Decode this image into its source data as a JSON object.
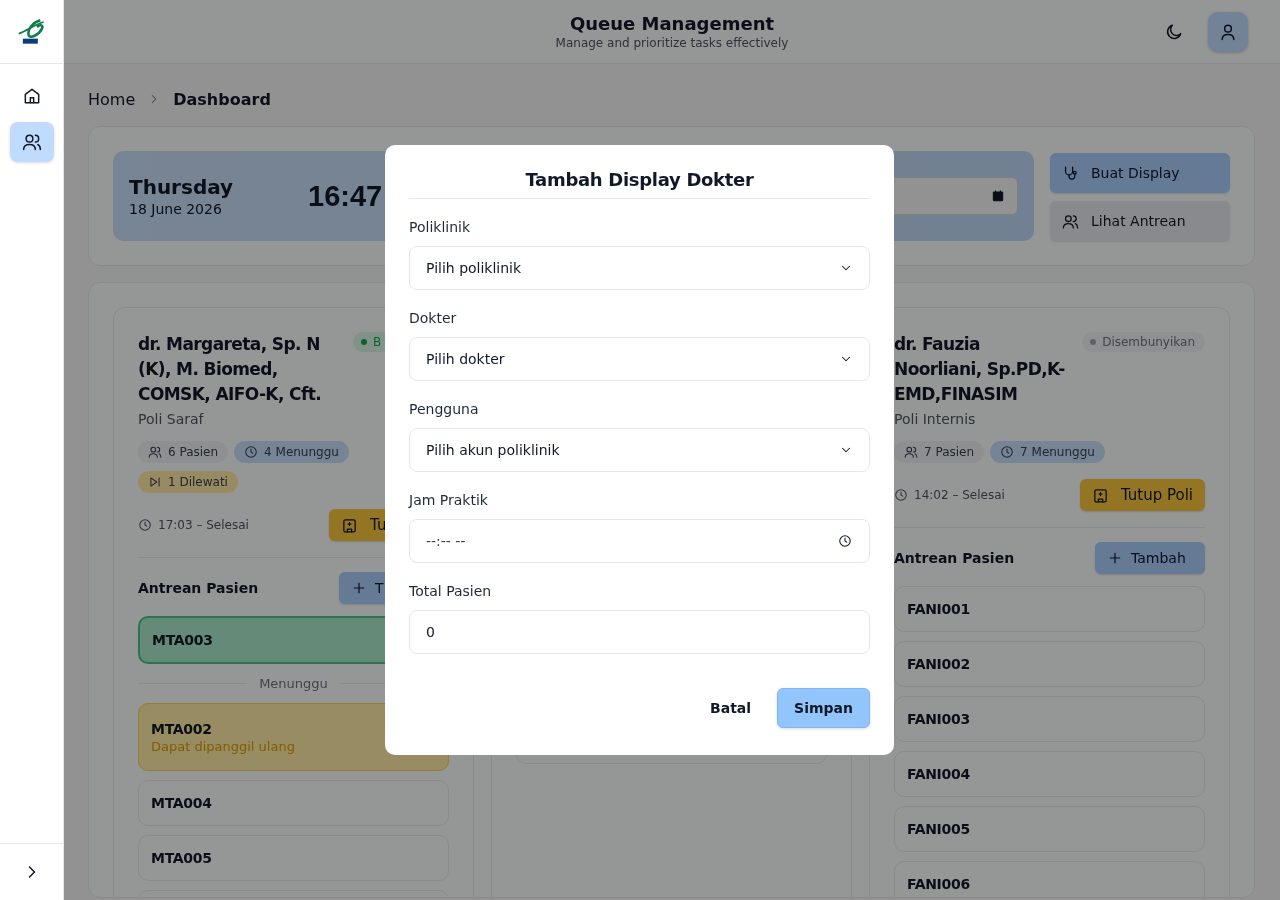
{
  "sidebar": {
    "items": [
      {
        "kind": "home",
        "selected": false
      },
      {
        "kind": "users",
        "selected": true
      }
    ]
  },
  "header": {
    "title": "Queue Management",
    "subtitle": "Manage and prioritize tasks effectively"
  },
  "breadcrumb": [
    "Home",
    "Dashboard"
  ],
  "today": {
    "day": "Thursday",
    "date": "18 June 2026",
    "time": "16:47"
  },
  "actions": [
    {
      "label": "Buat Display",
      "kind": "primary"
    },
    {
      "label": "Lihat Antrean",
      "kind": "secondary"
    }
  ],
  "doctors": [
    {
      "name": "dr. Margareta, Sp. N (K), M. Biomed, COMSK, AIFO-K, Cft.",
      "clinic": "Poli Saraf",
      "status": {
        "label": "B",
        "kind": "active"
      },
      "chips": [
        {
          "kind": "patients",
          "label": "6 Pasien"
        },
        {
          "kind": "waiting",
          "label": "4 Menunggu"
        },
        {
          "kind": "skipped",
          "label": "1 Dilewati"
        }
      ],
      "hours": "17:03 – Selesai",
      "close_label": "Tu",
      "queue_title": "Antrean Pasien",
      "add_label": "T",
      "queue": [
        {
          "kind": "current",
          "code": "MTA003"
        },
        {
          "kind": "divider",
          "label": "Menunggu"
        },
        {
          "kind": "skipped",
          "code": "MTA002",
          "note": "Dapat dipanggil ulang"
        },
        {
          "kind": "waiting",
          "code": "MTA004"
        },
        {
          "kind": "waiting",
          "code": "MTA005"
        },
        {
          "kind": "waiting"
        }
      ]
    },
    {
      "queue": [
        {
          "kind": "waiting"
        }
      ]
    },
    {
      "name": "dr. Fauzia Noorliani, Sp.PD,K-EMD,FINASIM",
      "clinic": "Poli Internis",
      "status": {
        "label": "Disembunyikan",
        "kind": "hidden"
      },
      "chips": [
        {
          "kind": "patients",
          "label": "7 Pasien"
        },
        {
          "kind": "waiting",
          "label": "7 Menunggu"
        }
      ],
      "hours": "14:02 – Selesai",
      "close_label": "Tutup Poli",
      "queue_title": "Antrean Pasien",
      "add_label": "Tambah",
      "queue": [
        {
          "kind": "waiting",
          "code": "FANI001"
        },
        {
          "kind": "waiting",
          "code": "FANI002"
        },
        {
          "kind": "waiting",
          "code": "FANI003"
        },
        {
          "kind": "waiting",
          "code": "FANI004"
        },
        {
          "kind": "waiting",
          "code": "FANI005"
        },
        {
          "kind": "waiting",
          "code": "FANI006"
        }
      ]
    }
  ],
  "dialog": {
    "title": "Tambah Display Dokter",
    "fields": [
      {
        "kind": "select",
        "label": "Poliklinik",
        "placeholder": "Pilih poliklinik"
      },
      {
        "kind": "select",
        "label": "Dokter",
        "placeholder": "Pilih dokter"
      },
      {
        "kind": "select",
        "label": "Pengguna",
        "placeholder": "Pilih akun poliklinik"
      },
      {
        "kind": "time",
        "label": "Jam Praktik",
        "placeholder": "--:-- --"
      },
      {
        "kind": "number",
        "label": "Total Pasien",
        "value": "0"
      }
    ],
    "buttons": [
      {
        "label": "Batal",
        "kind": "text"
      },
      {
        "label": "Simpan",
        "kind": "primary"
      }
    ]
  }
}
